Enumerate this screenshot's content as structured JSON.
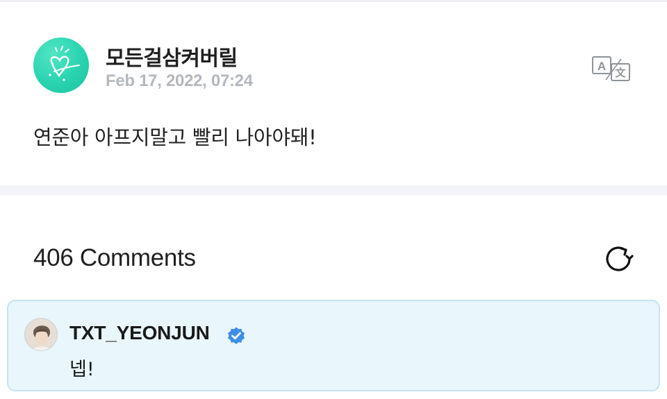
{
  "post": {
    "author": "모든걸삼켜버릴",
    "date": "Feb 17, 2022, 07:24",
    "content": "연준아 아프지말고 빨리 나아야돼!",
    "translate_icon": "translate-icon",
    "avatar_color": "#2ad3b0"
  },
  "comments": {
    "header": "406 Comments",
    "refresh_icon": "refresh-icon",
    "items": [
      {
        "author": "TXT_YEONJUN",
        "verified": true,
        "text": "넵!",
        "card_bg": "#e9f6fc",
        "verified_color": "#3d8ee8"
      }
    ]
  }
}
